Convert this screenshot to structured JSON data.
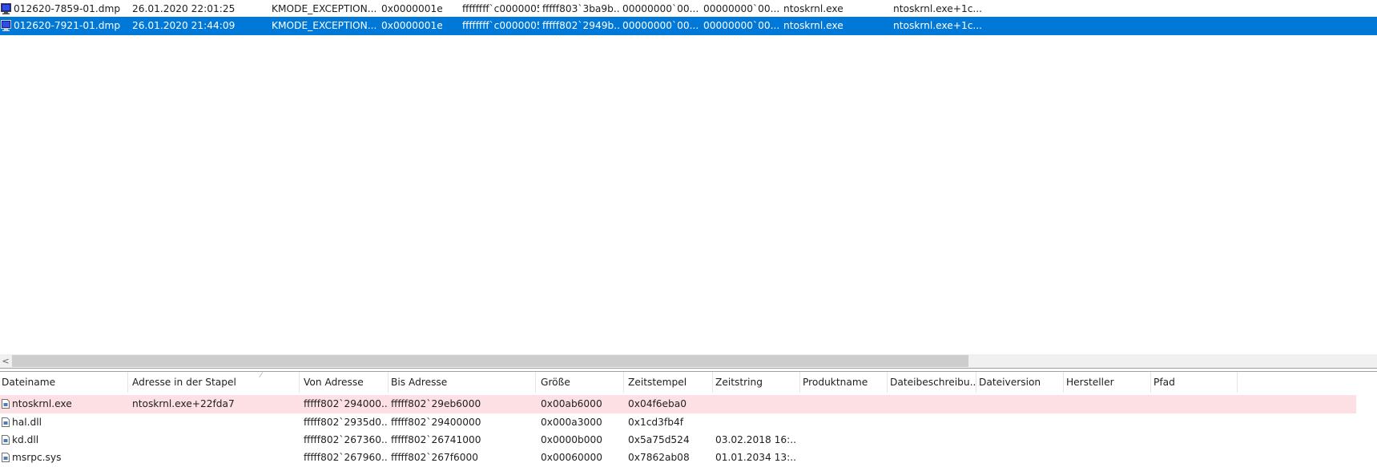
{
  "dump_list": {
    "rows": [
      {
        "filename": "012620-7859-01.dmp",
        "crash_time": "26.01.2020 22:01:25",
        "bug_check": "KMODE_EXCEPTION...",
        "code": "0x0000001e",
        "param1": "ffffffff`c0000005",
        "param2": "fffff803`3ba9b...",
        "param3": "00000000`00...",
        "param4": "00000000`00...",
        "driver": "ntoskrnl.exe",
        "address": "ntoskrnl.exe+1c...",
        "selected": false
      },
      {
        "filename": "012620-7921-01.dmp",
        "crash_time": "26.01.2020 21:44:09",
        "bug_check": "KMODE_EXCEPTION...",
        "code": "0x0000001e",
        "param1": "ffffffff`c0000005",
        "param2": "fffff802`2949b...",
        "param3": "00000000`00...",
        "param4": "00000000`00...",
        "driver": "ntoskrnl.exe",
        "address": "ntoskrnl.exe+1c...",
        "selected": true
      }
    ]
  },
  "scrollbar": {
    "left_arrow": "<"
  },
  "module_list": {
    "columns": [
      "Dateiname",
      "Adresse in der Stapel",
      "Von Adresse",
      "Bis Adresse",
      "Größe",
      "Zeitstempel",
      "Zeitstring",
      "Produktname",
      "Dateibeschreibu...",
      "Dateiversion",
      "Hersteller",
      "Pfad"
    ],
    "sort_indicator": "⁄",
    "rows": [
      {
        "name": "ntoskrnl.exe",
        "stack_addr": "ntoskrnl.exe+22fda7",
        "from": "fffff802`294000...",
        "to": "fffff802`29eb6000",
        "size": "0x00ab6000",
        "timestamp": "0x04f6eba0",
        "timestring": "",
        "highlight": true
      },
      {
        "name": "hal.dll",
        "stack_addr": "",
        "from": "fffff802`2935d0...",
        "to": "fffff802`29400000",
        "size": "0x000a3000",
        "timestamp": "0x1cd3fb4f",
        "timestring": "",
        "highlight": false
      },
      {
        "name": "kd.dll",
        "stack_addr": "",
        "from": "fffff802`267360...",
        "to": "fffff802`26741000",
        "size": "0x0000b000",
        "timestamp": "0x5a75d524",
        "timestring": "03.02.2018 16:...",
        "highlight": false
      },
      {
        "name": "msrpc.sys",
        "stack_addr": "",
        "from": "fffff802`267960...",
        "to": "fffff802`267f6000",
        "size": "0x00060000",
        "timestamp": "0x7862ab08",
        "timestring": "01.01.2034 13:...",
        "highlight": false
      }
    ]
  },
  "colors": {
    "selection": "#0078d7",
    "highlight_row": "#fde0e3"
  }
}
